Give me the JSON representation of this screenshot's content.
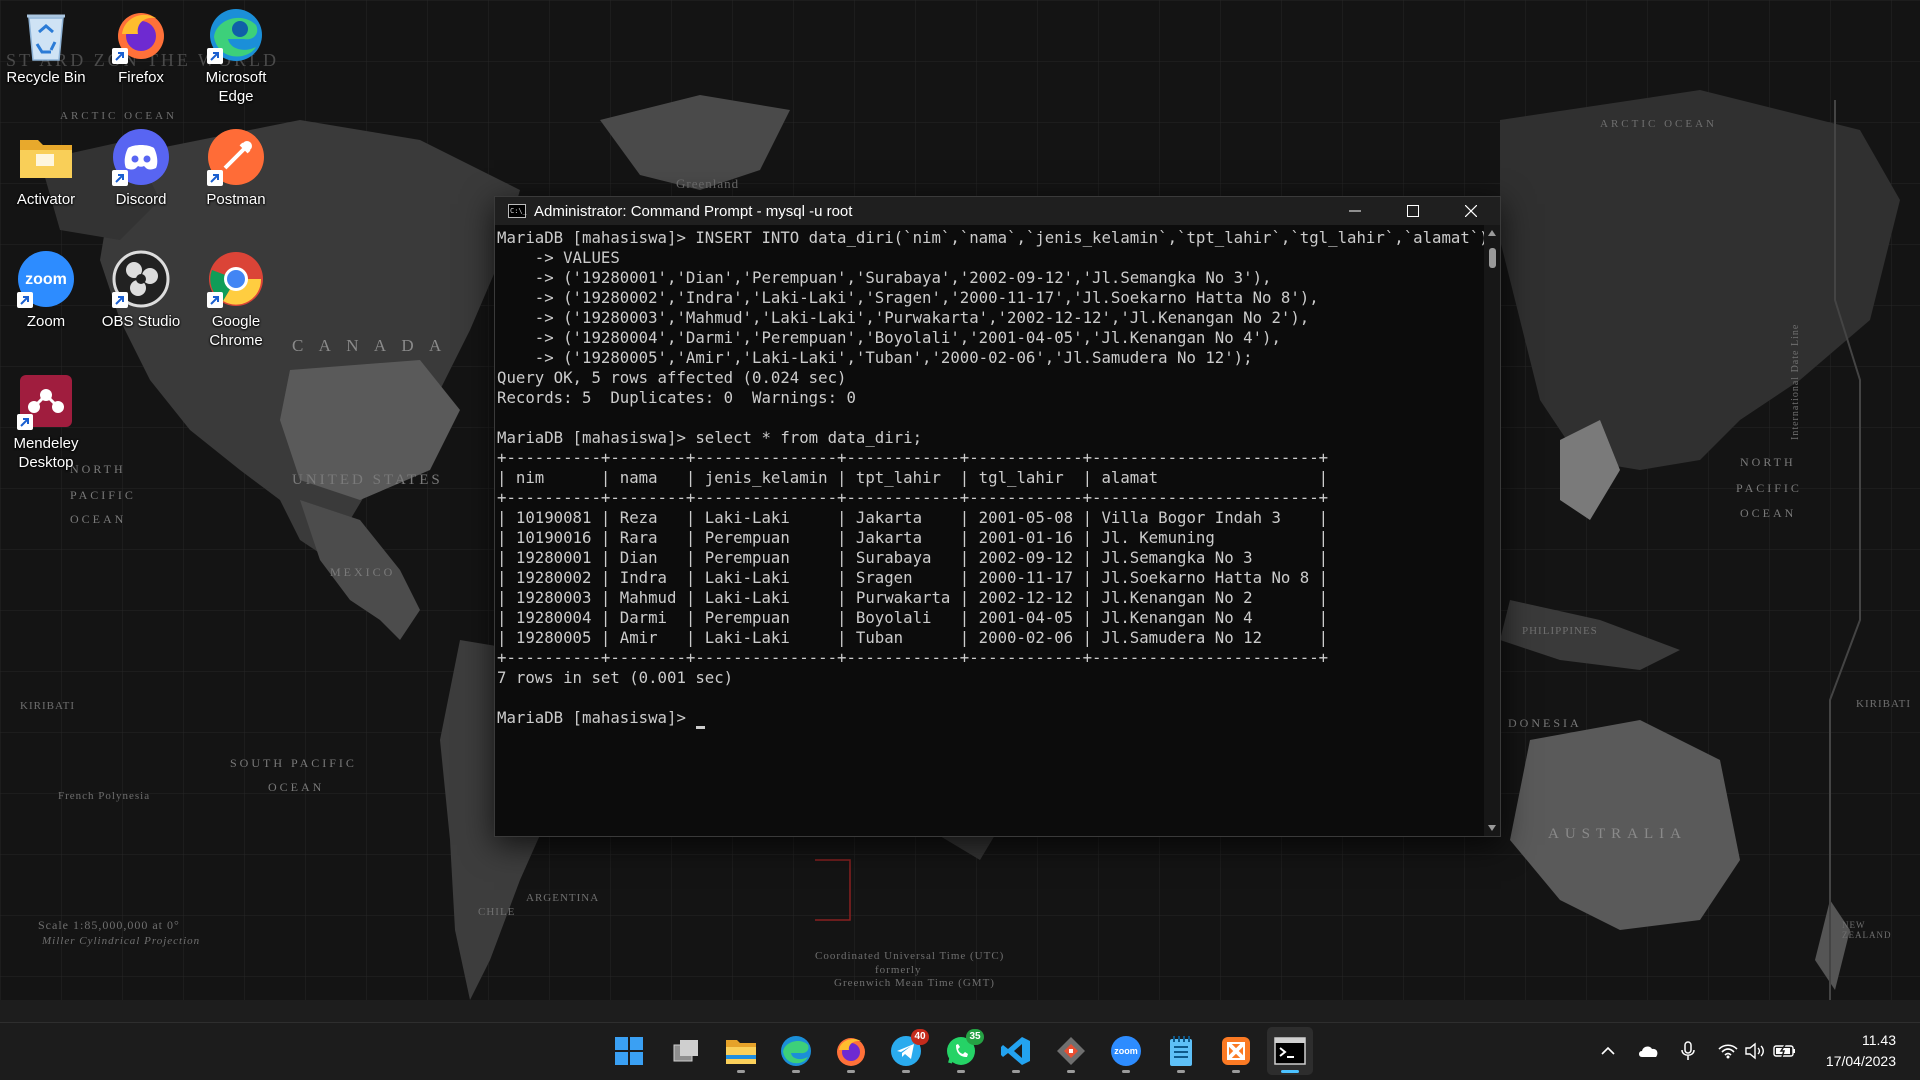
{
  "desktop": {
    "icons": [
      {
        "label": "Recycle Bin",
        "icon": "recycle-bin-icon"
      },
      {
        "label": "Firefox",
        "icon": "firefox-icon"
      },
      {
        "label": "Microsoft Edge",
        "icon": "edge-icon"
      },
      {
        "label": "Activator",
        "icon": "folder-icon"
      },
      {
        "label": "Discord",
        "icon": "discord-icon"
      },
      {
        "label": "Postman",
        "icon": "postman-icon"
      },
      {
        "label": "Zoom",
        "icon": "zoom-icon"
      },
      {
        "label": "OBS Studio",
        "icon": "obs-icon"
      },
      {
        "label": "Google Chrome",
        "icon": "chrome-icon"
      },
      {
        "label": "Mendeley Desktop",
        "icon": "mendeley-icon"
      }
    ]
  },
  "wallpaper": {
    "labels": {
      "title": "ST    ARD    ZON    THE WORLD",
      "canada": "C A N A D A",
      "us": "UNITED STATES",
      "mexico": "MEXICO",
      "north_pacific": "NORTH PACIFIC OCEAN",
      "south_pacific": "SOUTH   PACIFIC",
      "south_pacific_ocean": "OCEAN",
      "north_pacific_east": "NORTH",
      "pacific_east": "PACIFIC",
      "ocean_east": "OCEAN",
      "australia": "AUSTRALIA",
      "indonesia": "DONESIA",
      "philippines": "PHILIPPINES",
      "kiribati": "KIRIBATI",
      "kiribati_east": "KIRIBATI",
      "greenland": "Greenland",
      "arctic": "ARCTIC OCEAN",
      "arctic_east": "ARCTIC OCEAN",
      "french_polynesia": "French Polynesia",
      "chile": "CHILE",
      "argentina": "ARGENTINA",
      "new_zealand": "NEW ZEALAND",
      "scale": "Scale 1:85,000,000 at 0°",
      "projection": "Miller Cylindrical Projection",
      "utc": "Coordinated Universal Time (UTC)",
      "utc2": "formerly",
      "utc3": "Greenwich Mean Time (GMT)",
      "intl_date_line": "International Date Line"
    }
  },
  "console": {
    "title": "Administrator: Command Prompt - mysql  -u root",
    "app_icon_text": "C:\\_",
    "lines": [
      "MariaDB [mahasiswa]> INSERT INTO data_diri(`nim`,`nama`,`jenis_kelamin`,`tpt_lahir`,`tgl_lahir`,`alamat`)",
      "    -> VALUES",
      "    -> ('19280001','Dian','Perempuan','Surabaya','2002-09-12','Jl.Semangka No 3'),",
      "    -> ('19280002','Indra','Laki-Laki','Sragen','2000-11-17','Jl.Soekarno Hatta No 8'),",
      "    -> ('19280003','Mahmud','Laki-Laki','Purwakarta','2002-12-12','Jl.Kenangan No 2'),",
      "    -> ('19280004','Darmi','Perempuan','Boyolali','2001-04-05','Jl.Kenangan No 4'),",
      "    -> ('19280005','Amir','Laki-Laki','Tuban','2000-02-06','Jl.Samudera No 12');",
      "Query OK, 5 rows affected (0.024 sec)",
      "Records: 5  Duplicates: 0  Warnings: 0",
      "",
      "MariaDB [mahasiswa]> select * from data_diri;",
      "+----------+--------+---------------+------------+------------+------------------------+",
      "| nim      | nama   | jenis_kelamin | tpt_lahir  | tgl_lahir  | alamat                 |",
      "+----------+--------+---------------+------------+------------+------------------------+",
      "| 10190081 | Reza   | Laki-Laki     | Jakarta    | 2001-05-08 | Villa Bogor Indah 3    |",
      "| 10190016 | Rara   | Perempuan     | Jakarta    | 2001-01-16 | Jl. Kemuning           |",
      "| 19280001 | Dian   | Perempuan     | Surabaya   | 2002-09-12 | Jl.Semangka No 3       |",
      "| 19280002 | Indra  | Laki-Laki     | Sragen     | 2000-11-17 | Jl.Soekarno Hatta No 8 |",
      "| 19280003 | Mahmud | Laki-Laki     | Purwakarta | 2002-12-12 | Jl.Kenangan No 2       |",
      "| 19280004 | Darmi  | Perempuan     | Boyolali   | 2001-04-05 | Jl.Kenangan No 4       |",
      "| 19280005 | Amir   | Laki-Laki     | Tuban      | 2000-02-06 | Jl.Samudera No 12      |",
      "+----------+--------+---------------+------------+------------+------------------------+",
      "7 rows in set (0.001 sec)",
      "",
      "MariaDB [mahasiswa]> "
    ]
  },
  "taskbar": {
    "apps": [
      {
        "name": "start",
        "icon": "windows-start-icon"
      },
      {
        "name": "task-view",
        "icon": "task-view-icon"
      },
      {
        "name": "file-explorer",
        "icon": "folder-icon"
      },
      {
        "name": "edge",
        "icon": "edge-icon"
      },
      {
        "name": "firefox",
        "icon": "firefox-icon"
      },
      {
        "name": "telegram",
        "icon": "telegram-icon",
        "badge": "40"
      },
      {
        "name": "whatsapp",
        "icon": "whatsapp-icon",
        "badge": "35"
      },
      {
        "name": "vscode",
        "icon": "vscode-icon"
      },
      {
        "name": "git",
        "icon": "git-icon"
      },
      {
        "name": "zoom",
        "icon": "zoom-icon"
      },
      {
        "name": "notepad",
        "icon": "notepad-icon"
      },
      {
        "name": "xampp",
        "icon": "xampp-icon"
      },
      {
        "name": "command-prompt",
        "icon": "terminal-icon"
      }
    ],
    "zoom_text": "zoom",
    "clock": {
      "time": "11.43",
      "date": "17/04/2023"
    }
  },
  "colors": {
    "console_bg": "#0c0c0c",
    "console_text": "#cccccc",
    "taskbar_bg": "#1c1c1c",
    "accent": "#4cc2ff"
  }
}
